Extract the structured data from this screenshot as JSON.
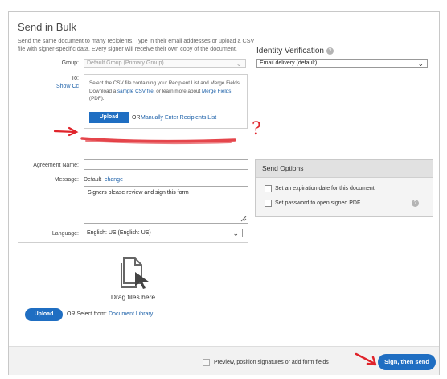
{
  "header": {
    "title": "Send in Bulk",
    "description": "Send the same document to many recipients. Type in their email addresses or upload a CSV file with signer-specific data. Every signer will receive their own copy of the document."
  },
  "form": {
    "group_label": "Group:",
    "group_value": "Default Group (Primary Group)",
    "to_label": "To:",
    "show_cc": "Show Cc",
    "csv_text_1": "Select the CSV file containing your Recipient List and Merge Fields. Download a ",
    "csv_sample_link": "sample CSV file",
    "csv_text_2": ", or learn more about ",
    "csv_merge_link": "Merge Fields",
    "csv_text_3": " (PDF).",
    "upload_label": "Upload",
    "or_text": "OR",
    "manual_link": "Manually Enter Recipients List",
    "agreement_label": "Agreement Name:",
    "message_label": "Message:",
    "message_default": "Default",
    "message_change": "change",
    "message_text": "Signers please review and sign this form",
    "language_label": "Language:",
    "language_value": "English: US (English: US)"
  },
  "identity": {
    "title": "Identity Verification",
    "help": "?",
    "value": "Email delivery (default)"
  },
  "send_options": {
    "title": "Send Options",
    "expiration": "Set an expiration date for this document",
    "password": "Set password to open signed PDF",
    "help": "?"
  },
  "files": {
    "drag_text": "Drag files here",
    "upload_label": "Upload",
    "or_select": "OR Select from:",
    "library_link": "Document Library"
  },
  "footer": {
    "preview_label": "Preview, position signatures or add form fields",
    "sign_button": "Sign, then send"
  },
  "annotation": {
    "question_mark": "?"
  },
  "colors": {
    "accent_blue": "#1f6ec2",
    "link_blue": "#1a5fa8",
    "annotation_red": "#e0242b"
  }
}
